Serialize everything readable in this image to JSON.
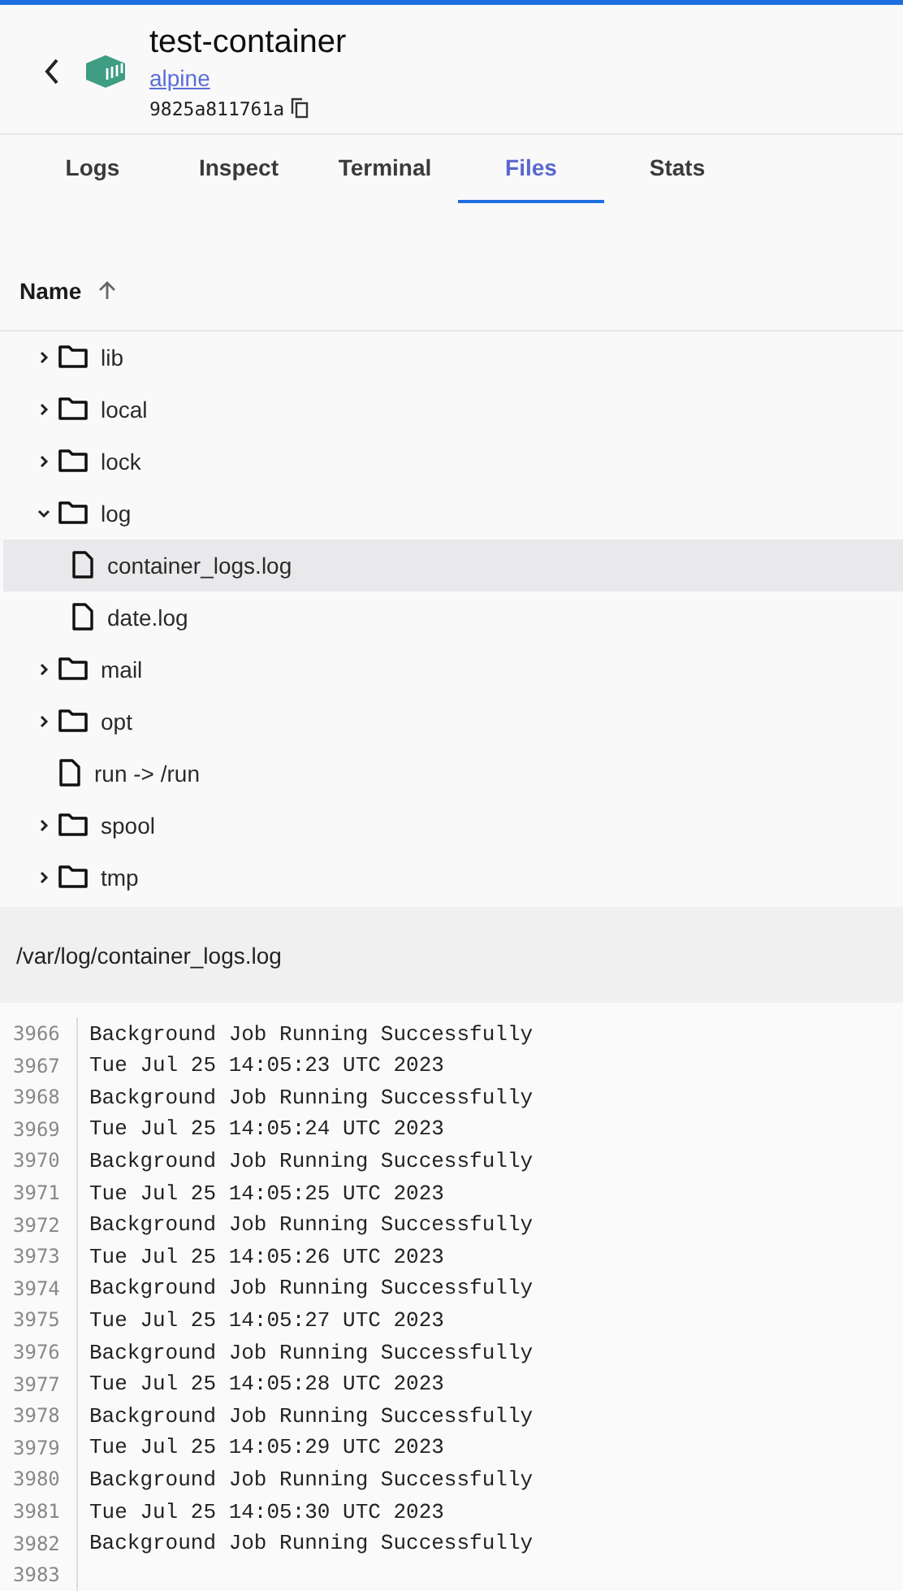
{
  "header": {
    "title": "test-container",
    "image_link": "alpine",
    "container_id": "9825a811761a"
  },
  "tabs": [
    {
      "label": "Logs",
      "selected": false
    },
    {
      "label": "Inspect",
      "selected": false
    },
    {
      "label": "Terminal",
      "selected": false
    },
    {
      "label": "Files",
      "selected": true
    },
    {
      "label": "Stats",
      "selected": false
    }
  ],
  "file_tree": {
    "column_header": "Name",
    "items": [
      {
        "name": "lib",
        "kind": "folder",
        "expanded": false,
        "selected": false
      },
      {
        "name": "local",
        "kind": "folder",
        "expanded": false,
        "selected": false
      },
      {
        "name": "lock",
        "kind": "folder",
        "expanded": false,
        "selected": false
      },
      {
        "name": "log",
        "kind": "folder",
        "expanded": true,
        "selected": false,
        "children": [
          {
            "name": "container_logs.log",
            "kind": "file",
            "selected": true
          },
          {
            "name": "date.log",
            "kind": "file",
            "selected": false
          }
        ]
      },
      {
        "name": "mail",
        "kind": "folder",
        "expanded": false,
        "selected": false
      },
      {
        "name": "opt",
        "kind": "folder",
        "expanded": false,
        "selected": false
      },
      {
        "name": "run -> /run",
        "kind": "file",
        "selected": false
      },
      {
        "name": "spool",
        "kind": "folder",
        "expanded": false,
        "selected": false
      },
      {
        "name": "tmp",
        "kind": "folder",
        "expanded": false,
        "selected": false
      }
    ]
  },
  "file_viewer": {
    "path": "/var/log/container_logs.log",
    "lines": [
      {
        "number": "3966",
        "text": "Background Job Running Successfully"
      },
      {
        "number": "3967",
        "text": "Tue Jul 25 14:05:23 UTC 2023"
      },
      {
        "number": "3968",
        "text": "Background Job Running Successfully"
      },
      {
        "number": "3969",
        "text": "Tue Jul 25 14:05:24 UTC 2023"
      },
      {
        "number": "3970",
        "text": "Background Job Running Successfully"
      },
      {
        "number": "3971",
        "text": "Tue Jul 25 14:05:25 UTC 2023"
      },
      {
        "number": "3972",
        "text": "Background Job Running Successfully"
      },
      {
        "number": "3973",
        "text": "Tue Jul 25 14:05:26 UTC 2023"
      },
      {
        "number": "3974",
        "text": "Background Job Running Successfully"
      },
      {
        "number": "3975",
        "text": "Tue Jul 25 14:05:27 UTC 2023"
      },
      {
        "number": "3976",
        "text": "Background Job Running Successfully"
      },
      {
        "number": "3977",
        "text": "Tue Jul 25 14:05:28 UTC 2023"
      },
      {
        "number": "3978",
        "text": "Background Job Running Successfully"
      },
      {
        "number": "3979",
        "text": "Tue Jul 25 14:05:29 UTC 2023"
      },
      {
        "number": "3980",
        "text": "Background Job Running Successfully"
      },
      {
        "number": "3981",
        "text": "Tue Jul 25 14:05:30 UTC 2023"
      },
      {
        "number": "3982",
        "text": "Background Job Running Successfully"
      },
      {
        "number": "3983"
      }
    ]
  }
}
